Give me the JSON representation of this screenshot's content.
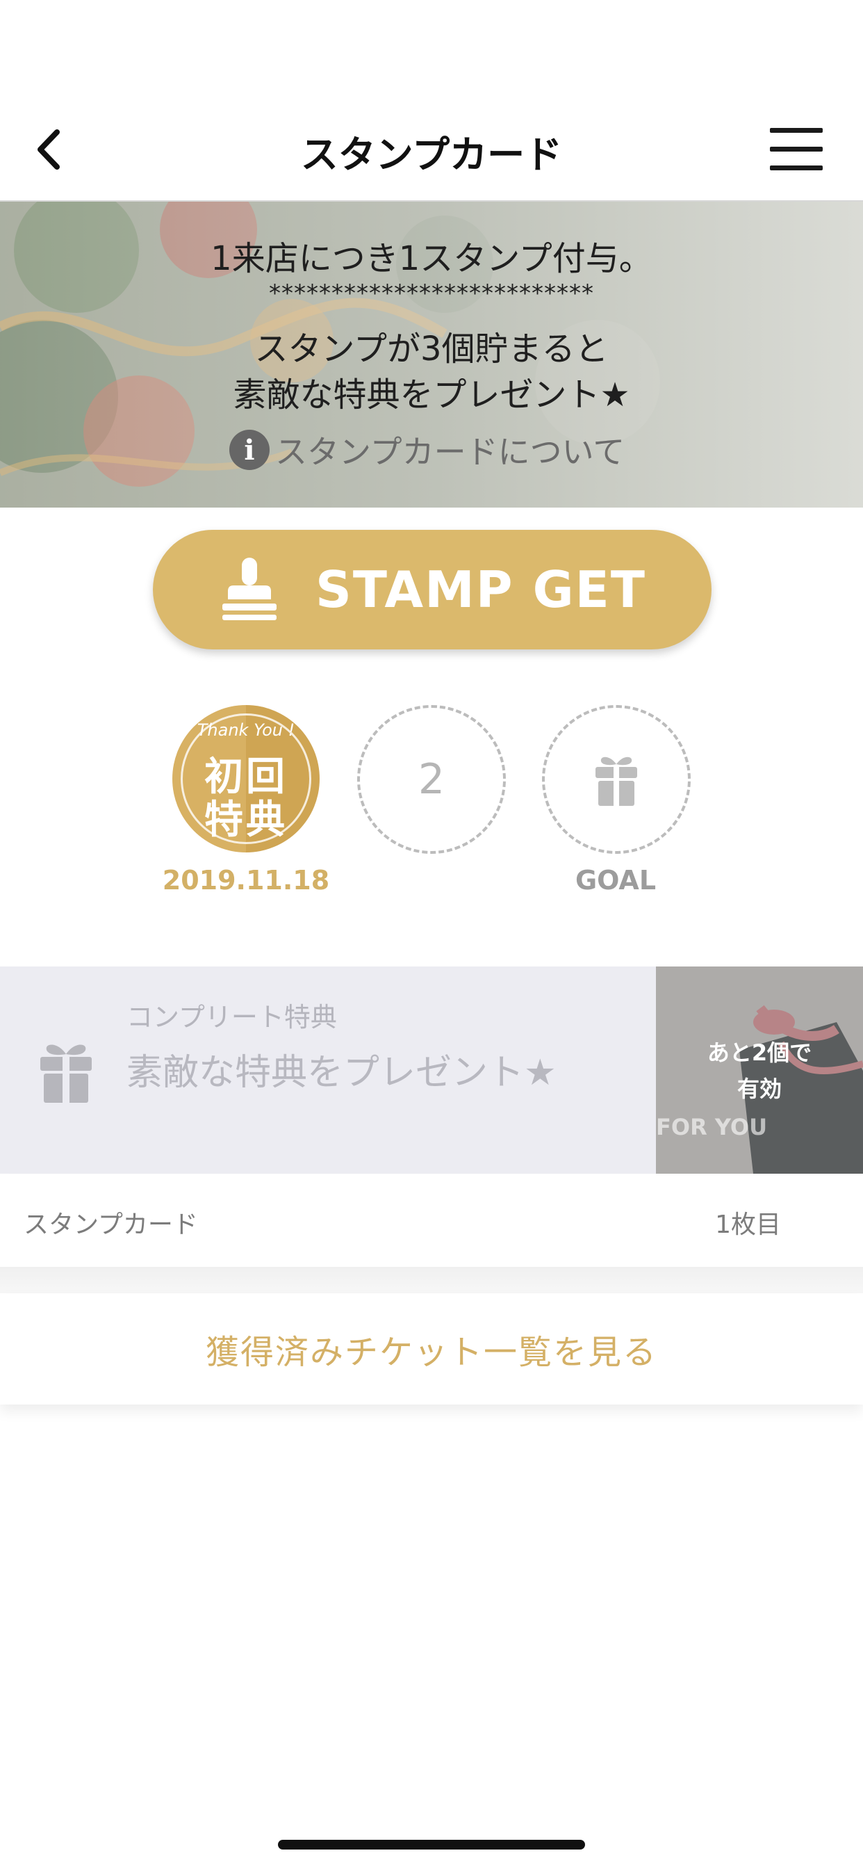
{
  "header": {
    "title": "スタンプカード",
    "back_icon": "chevron-left-icon",
    "menu_icon": "hamburger-menu-icon"
  },
  "banner": {
    "line1": "1来店につき1スタンプ付与。",
    "line2": "**************************",
    "line3": "スタンプが3個貯まると",
    "line4": "素敵な特典をプレゼント★",
    "about_link": "スタンプカードについて",
    "info_icon": "info-icon"
  },
  "stamp_button": {
    "label": "STAMP GET",
    "icon": "stamp-icon",
    "color": "#dbb96c"
  },
  "stamps": {
    "slot1": {
      "badge_small": "Thank You !",
      "badge_line1": "初回",
      "badge_line2": "特典",
      "date": "2019.11.18"
    },
    "slot2": {
      "number": "2"
    },
    "slot3": {
      "caption": "GOAL",
      "icon": "gift-icon"
    }
  },
  "complete_reward": {
    "label": "コンプリート特典",
    "text": "素敵な特典をプレゼント★",
    "remaining_line1": "あと2個で",
    "remaining_line2": "有効",
    "image_text": "FOR YOU",
    "icon": "gift-icon"
  },
  "card_info": {
    "label": "スタンプカード",
    "count": "1枚目"
  },
  "tickets_link": "獲得済みチケット一覧を見る",
  "colors": {
    "accent_gold": "#dbb96c",
    "text_gold": "#d4b066",
    "muted_gray": "#b5b5b5"
  }
}
